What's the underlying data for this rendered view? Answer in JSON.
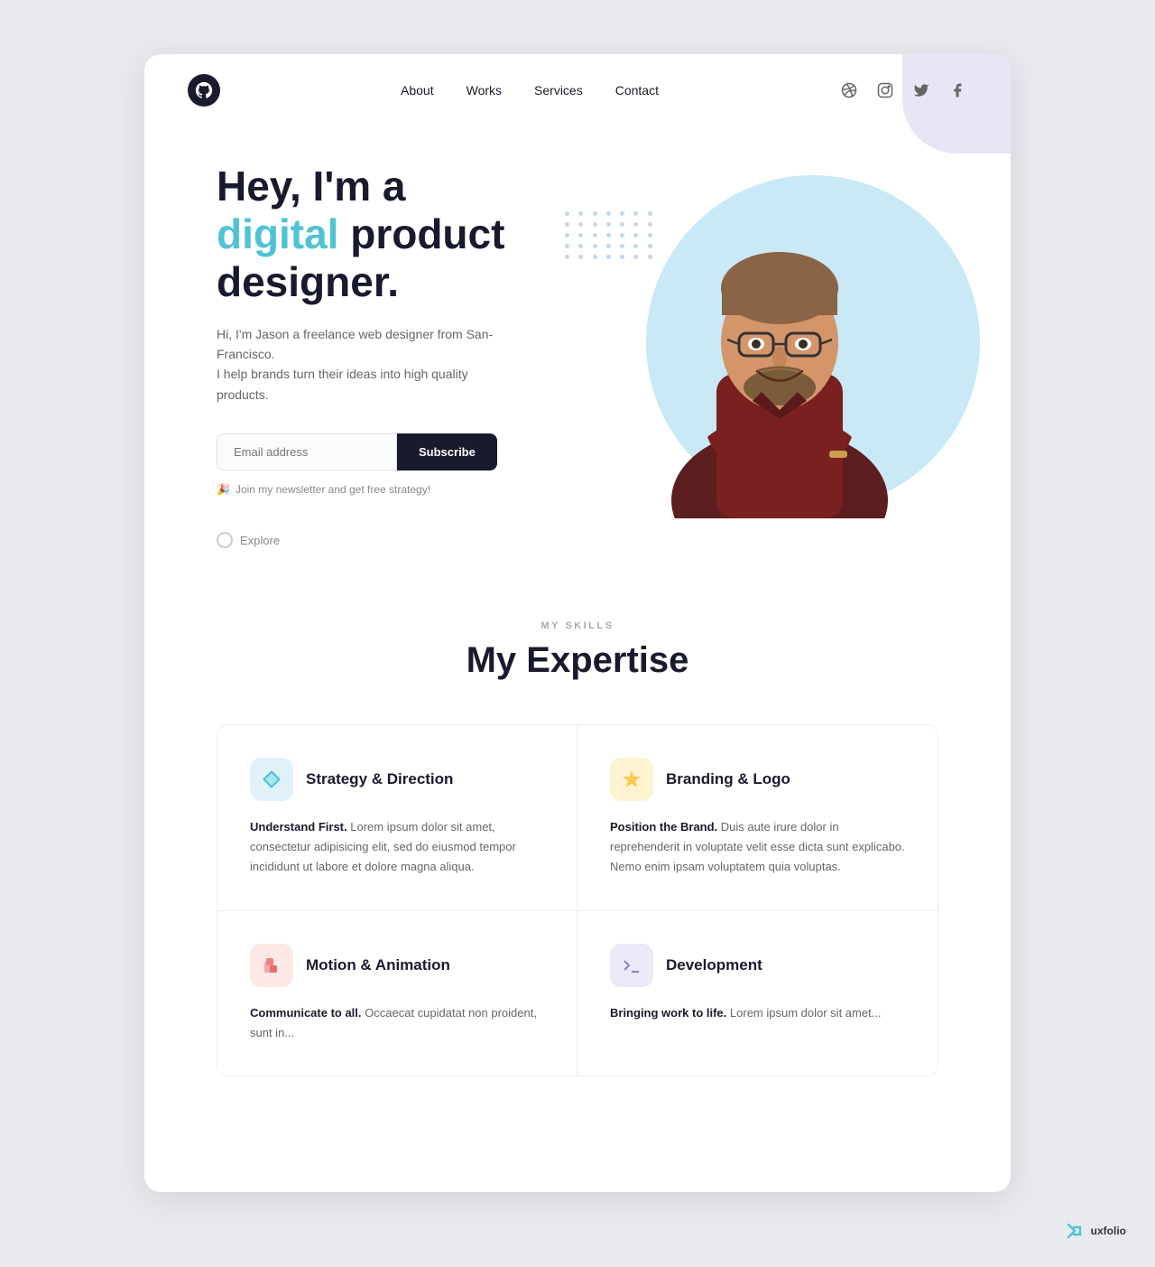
{
  "nav": {
    "logo_char": "●",
    "links": [
      {
        "label": "About",
        "id": "about"
      },
      {
        "label": "Works",
        "id": "works"
      },
      {
        "label": "Services",
        "id": "services"
      },
      {
        "label": "Contact",
        "id": "contact"
      }
    ],
    "social": [
      {
        "name": "dribbble",
        "icon": "⊕"
      },
      {
        "name": "instagram",
        "icon": "◎"
      },
      {
        "name": "twitter",
        "icon": "𝕏"
      },
      {
        "name": "facebook",
        "icon": "f"
      }
    ]
  },
  "hero": {
    "line1": "Hey, I'm a",
    "highlight": "digital",
    "line2": "product",
    "line3": "designer.",
    "description": "Hi, I'm Jason a freelance web designer from San-Francisco.\nI help brands turn their ideas into high quality products.",
    "email_placeholder": "Email address",
    "subscribe_btn": "Subscribe",
    "newsletter_text": "Join my newsletter and get free strategy!",
    "explore_text": "Explore"
  },
  "skills": {
    "section_label": "MY SKILLS",
    "section_title": "My Expertise",
    "cards": [
      {
        "icon": "◇",
        "icon_style": "blue",
        "title": "Strategy & Direction",
        "bold": "Understand First.",
        "body": "Lorem ipsum dolor sit amet, consectetur adipisicing elit, sed do eiusmod tempor incididunt ut labore et dolore magna aliqua."
      },
      {
        "icon": "⬟",
        "icon_style": "yellow",
        "title": "Branding & Logo",
        "bold": "Position the Brand.",
        "body": "Duis aute irure dolor in reprehenderit in voluptate velit esse dicta sunt explicabo. Nemo enim ipsam voluptatem quia voluptas."
      },
      {
        "icon": "❐",
        "icon_style": "pink",
        "title": "Motion & Animation",
        "bold": "Communicate to all.",
        "body": "Occaecat cupidatat non proident, sunt in..."
      },
      {
        "icon": ">_",
        "icon_style": "purple",
        "title": "Development",
        "bold": "Bringing work to life.",
        "body": "Lorem ipsum dolor sit amet..."
      }
    ]
  },
  "footer": {
    "brand": "uxfolio"
  }
}
